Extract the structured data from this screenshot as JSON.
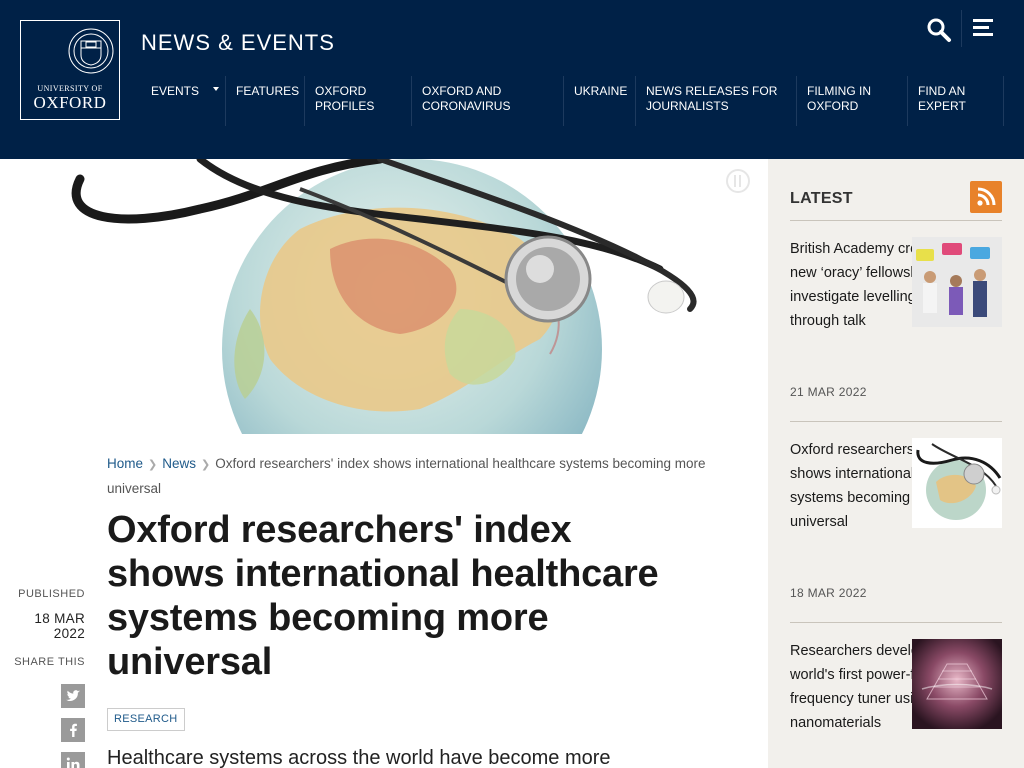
{
  "header": {
    "university_line": "UNIVERSITY OF",
    "oxford_line": "OXFORD",
    "site_title": "NEWS & EVENTS"
  },
  "nav": {
    "items": [
      {
        "label": "EVENTS"
      },
      {
        "label": "FEATURES"
      },
      {
        "label": "OXFORD PROFILES"
      },
      {
        "label": "OXFORD AND CORONAVIRUS"
      },
      {
        "label": "UKRAINE"
      },
      {
        "label": "NEWS RELEASES FOR JOURNALISTS"
      },
      {
        "label": "FILMING IN OXFORD"
      },
      {
        "label": "FIND AN EXPERT"
      }
    ]
  },
  "breadcrumb": {
    "home": "Home",
    "news": "News",
    "current": "Oxford researchers' index shows international healthcare systems becoming more universal"
  },
  "article": {
    "title": "Oxford researchers' index shows international healthcare systems becoming more universal",
    "published_label": "PUBLISHED",
    "published_date": "18 MAR 2022",
    "share_label": "SHARE THIS",
    "tag": "RESEARCH",
    "lead": "Healthcare systems across the world have become more"
  },
  "sidebar": {
    "title": "LATEST",
    "cards": [
      {
        "title": "British Academy creates new ‘oracy’ fellowship - to investigate levelling up through talk",
        "date": "21 MAR 2022"
      },
      {
        "title": "Oxford researchers' index shows international healthcare systems becoming more universal",
        "date": "18 MAR 2022"
      },
      {
        "title": "Researchers develop the world's first power-free frequency tuner using nanomaterials",
        "date": ""
      }
    ]
  },
  "colors": {
    "oxford_blue": "#002147",
    "link": "#1f5a8a",
    "rss": "#e8822a",
    "sidebar_bg": "#f2f0ec"
  }
}
